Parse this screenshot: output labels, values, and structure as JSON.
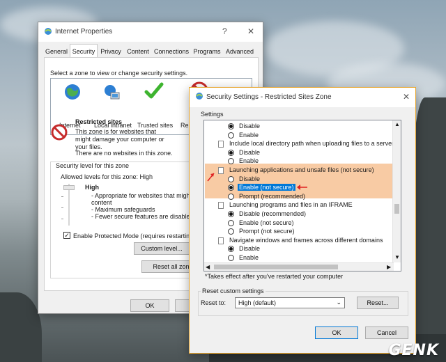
{
  "ie": {
    "title": "Internet Properties",
    "help": "?",
    "close": "✕",
    "tabs": [
      "General",
      "Security",
      "Privacy",
      "Content",
      "Connections",
      "Programs",
      "Advanced"
    ],
    "prompt": "Select a zone to view or change security settings.",
    "zones": [
      "Internet",
      "Local intranet",
      "Trusted sites",
      "Re"
    ],
    "zone_title": "Restricted sites",
    "zone_desc": "This zone is for websites that might damage your computer or your files.",
    "zone_empty": "There are no websites in this zone.",
    "level_group": "Security level for this zone",
    "allowed": "Allowed levels for this zone: High",
    "level_name": "High",
    "bullets": [
      "- Appropriate for websites that might",
      "content",
      "- Maximum safeguards",
      "- Fewer secure features are disabled"
    ],
    "protected_mode": "Enable Protected Mode (requires restarting I",
    "custom_level": "Custom level...",
    "reset_all": "Reset all zone",
    "ok": "OK",
    "cancel": "C"
  },
  "ss": {
    "title": "Security Settings - Restricted Sites Zone",
    "close": "✕",
    "settings_label": "Settings",
    "rows": [
      {
        "type": "radio",
        "text": "Disable",
        "checked": true
      },
      {
        "type": "radio",
        "text": "Enable",
        "checked": false
      },
      {
        "type": "header",
        "text": "Include local directory path when uploading files to a server"
      },
      {
        "type": "radio",
        "text": "Disable",
        "checked": true
      },
      {
        "type": "radio",
        "text": "Enable",
        "checked": false
      },
      {
        "type": "header",
        "text": "Launching applications and unsafe files (not secure)"
      },
      {
        "type": "radio",
        "text": "Disable",
        "checked": false
      },
      {
        "type": "radio",
        "text": "Enable (not secure)",
        "checked": true,
        "selected": true
      },
      {
        "type": "radio",
        "text": "Prompt (recommended)",
        "checked": false
      },
      {
        "type": "header",
        "text": "Launching programs and files in an IFRAME"
      },
      {
        "type": "radio",
        "text": "Disable (recommended)",
        "checked": true
      },
      {
        "type": "radio",
        "text": "Enable (not secure)",
        "checked": false
      },
      {
        "type": "radio",
        "text": "Prompt (not secure)",
        "checked": false
      },
      {
        "type": "header",
        "text": "Navigate windows and frames across different domains"
      },
      {
        "type": "radio",
        "text": "Disable",
        "checked": true
      },
      {
        "type": "radio",
        "text": "Enable",
        "checked": false
      }
    ],
    "footnote": "*Takes effect after you've restarted your computer",
    "reset_group": "Reset custom settings",
    "reset_to": "Reset to:",
    "reset_value": "High (default)",
    "reset_button": "Reset...",
    "ok": "OK",
    "cancel": "Cancel"
  },
  "watermark": "GENK",
  "colors": {
    "highlight": "#f8cba4",
    "selection": "#0078d7",
    "annotation_arrow": "#e02020"
  }
}
